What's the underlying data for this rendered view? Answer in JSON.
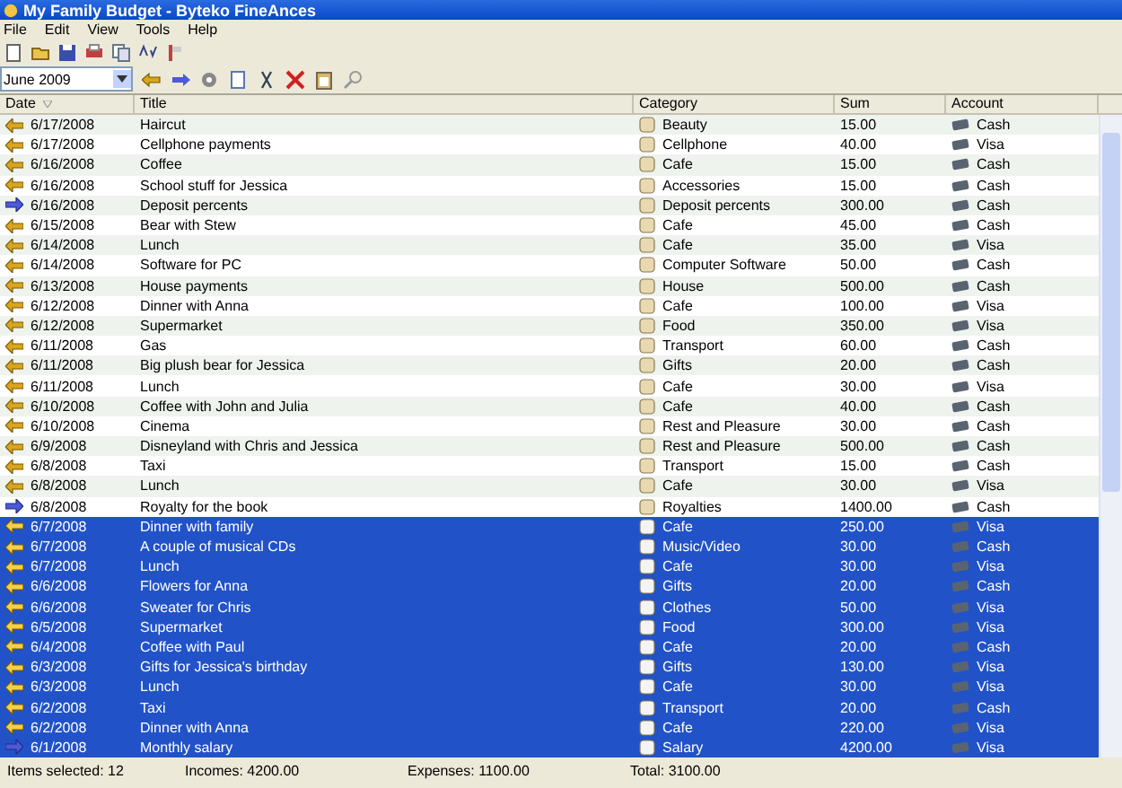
{
  "window": {
    "title": "My Family Budget - Byteko FineAnces"
  },
  "menu": [
    "File",
    "Edit",
    "View",
    "Tools",
    "Help"
  ],
  "period": {
    "value": "June 2009"
  },
  "table": {
    "columns": [
      "Date",
      "Title",
      "Category",
      "Sum",
      "Account"
    ],
    "rows": [
      {
        "kind": "expense",
        "date": "6/17/2008",
        "title": "Haircut",
        "category": "Beauty",
        "sum": "15.00",
        "account": "Cash",
        "selected": false
      },
      {
        "kind": "expense",
        "date": "6/17/2008",
        "title": "Cellphone payments",
        "category": "Cellphone",
        "sum": "40.00",
        "account": "Visa",
        "selected": false
      },
      {
        "kind": "expense",
        "date": "6/16/2008",
        "title": "Coffee",
        "category": "Cafe",
        "sum": "15.00",
        "account": "Cash",
        "selected": false
      },
      {
        "kind": "expense",
        "date": "6/16/2008",
        "title": "School stuff for Jessica",
        "category": "Accessories",
        "sum": "15.00",
        "account": "Cash",
        "selected": false
      },
      {
        "kind": "income",
        "date": "6/16/2008",
        "title": "Deposit percents",
        "category": "Deposit percents",
        "sum": "300.00",
        "account": "Cash",
        "selected": false
      },
      {
        "kind": "expense",
        "date": "6/15/2008",
        "title": "Bear with Stew",
        "category": "Cafe",
        "sum": "45.00",
        "account": "Cash",
        "selected": false
      },
      {
        "kind": "expense",
        "date": "6/14/2008",
        "title": "Lunch",
        "category": "Cafe",
        "sum": "35.00",
        "account": "Visa",
        "selected": false
      },
      {
        "kind": "expense",
        "date": "6/14/2008",
        "title": "Software for PC",
        "category": "Computer Software",
        "sum": "50.00",
        "account": "Cash",
        "selected": false
      },
      {
        "kind": "expense",
        "date": "6/13/2008",
        "title": "House payments",
        "category": "House",
        "sum": "500.00",
        "account": "Cash",
        "selected": false
      },
      {
        "kind": "expense",
        "date": "6/12/2008",
        "title": "Dinner with Anna",
        "category": "Cafe",
        "sum": "100.00",
        "account": "Visa",
        "selected": false
      },
      {
        "kind": "expense",
        "date": "6/12/2008",
        "title": "Supermarket",
        "category": "Food",
        "sum": "350.00",
        "account": "Visa",
        "selected": false
      },
      {
        "kind": "expense",
        "date": "6/11/2008",
        "title": "Gas",
        "category": "Transport",
        "sum": "60.00",
        "account": "Cash",
        "selected": false
      },
      {
        "kind": "expense",
        "date": "6/11/2008",
        "title": "Big plush bear for Jessica",
        "category": "Gifts",
        "sum": "20.00",
        "account": "Cash",
        "selected": false
      },
      {
        "kind": "expense",
        "date": "6/11/2008",
        "title": "Lunch",
        "category": "Cafe",
        "sum": "30.00",
        "account": "Visa",
        "selected": false
      },
      {
        "kind": "expense",
        "date": "6/10/2008",
        "title": "Coffee with John and Julia",
        "category": "Cafe",
        "sum": "40.00",
        "account": "Cash",
        "selected": false
      },
      {
        "kind": "expense",
        "date": "6/10/2008",
        "title": "Cinema",
        "category": "Rest and Pleasure",
        "sum": "30.00",
        "account": "Cash",
        "selected": false
      },
      {
        "kind": "expense",
        "date": "6/9/2008",
        "title": "Disneyland with Chris and Jessica",
        "category": "Rest and Pleasure",
        "sum": "500.00",
        "account": "Cash",
        "selected": false
      },
      {
        "kind": "expense",
        "date": "6/8/2008",
        "title": "Taxi",
        "category": "Transport",
        "sum": "15.00",
        "account": "Cash",
        "selected": false
      },
      {
        "kind": "expense",
        "date": "6/8/2008",
        "title": "Lunch",
        "category": "Cafe",
        "sum": "30.00",
        "account": "Visa",
        "selected": false
      },
      {
        "kind": "income",
        "date": "6/8/2008",
        "title": "Royalty for the book",
        "category": "Royalties",
        "sum": "1400.00",
        "account": "Cash",
        "selected": false
      },
      {
        "kind": "expense",
        "date": "6/7/2008",
        "title": "Dinner with family",
        "category": "Cafe",
        "sum": "250.00",
        "account": "Visa",
        "selected": true
      },
      {
        "kind": "expense",
        "date": "6/7/2008",
        "title": "A couple of musical CDs",
        "category": "Music/Video",
        "sum": "30.00",
        "account": "Cash",
        "selected": true
      },
      {
        "kind": "expense",
        "date": "6/7/2008",
        "title": "Lunch",
        "category": "Cafe",
        "sum": "30.00",
        "account": "Visa",
        "selected": true
      },
      {
        "kind": "expense",
        "date": "6/6/2008",
        "title": "Flowers for Anna",
        "category": "Gifts",
        "sum": "20.00",
        "account": "Cash",
        "selected": true
      },
      {
        "kind": "expense",
        "date": "6/6/2008",
        "title": "Sweater for Chris",
        "category": "Clothes",
        "sum": "50.00",
        "account": "Visa",
        "selected": true
      },
      {
        "kind": "expense",
        "date": "6/5/2008",
        "title": "Supermarket",
        "category": "Food",
        "sum": "300.00",
        "account": "Visa",
        "selected": true
      },
      {
        "kind": "expense",
        "date": "6/4/2008",
        "title": "Coffee with Paul",
        "category": "Cafe",
        "sum": "20.00",
        "account": "Cash",
        "selected": true
      },
      {
        "kind": "expense",
        "date": "6/3/2008",
        "title": "Gifts for Jessica's birthday",
        "category": "Gifts",
        "sum": "130.00",
        "account": "Visa",
        "selected": true
      },
      {
        "kind": "expense",
        "date": "6/3/2008",
        "title": "Lunch",
        "category": "Cafe",
        "sum": "30.00",
        "account": "Visa",
        "selected": true
      },
      {
        "kind": "expense",
        "date": "6/2/2008",
        "title": "Taxi",
        "category": "Transport",
        "sum": "20.00",
        "account": "Cash",
        "selected": true
      },
      {
        "kind": "expense",
        "date": "6/2/2008",
        "title": "Dinner with Anna",
        "category": "Cafe",
        "sum": "220.00",
        "account": "Visa",
        "selected": true
      },
      {
        "kind": "income",
        "date": "6/1/2008",
        "title": "Monthly salary",
        "category": "Salary",
        "sum": "4200.00",
        "account": "Visa",
        "selected": true
      }
    ]
  },
  "status_bar": [
    "Items selected: 12",
    "Incomes: 4200.00",
    "Expenses: 1100.00",
    "Total: 3100.00"
  ]
}
